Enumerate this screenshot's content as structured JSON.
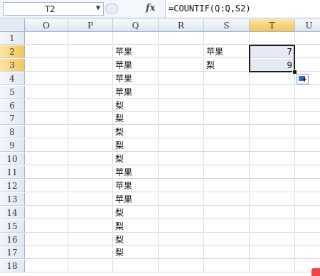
{
  "formula_bar": {
    "name_box": "T2",
    "fx_label": "fx",
    "formula": "=COUNTIF(Q:Q,S2)"
  },
  "columns": [
    "O",
    "P",
    "Q",
    "R",
    "S",
    "T",
    "U"
  ],
  "active_column": "T",
  "rows": [
    {
      "n": "1",
      "Q": "",
      "S": "",
      "T": ""
    },
    {
      "n": "2",
      "Q": "苹果",
      "S": "苹果",
      "T": "7"
    },
    {
      "n": "3",
      "Q": "苹果",
      "S": "梨",
      "T": "9"
    },
    {
      "n": "4",
      "Q": "苹果",
      "S": "",
      "T": ""
    },
    {
      "n": "5",
      "Q": "苹果",
      "S": "",
      "T": ""
    },
    {
      "n": "6",
      "Q": "梨",
      "S": "",
      "T": ""
    },
    {
      "n": "7",
      "Q": "梨",
      "S": "",
      "T": ""
    },
    {
      "n": "8",
      "Q": "梨",
      "S": "",
      "T": ""
    },
    {
      "n": "9",
      "Q": "梨",
      "S": "",
      "T": ""
    },
    {
      "n": "10",
      "Q": "梨",
      "S": "",
      "T": ""
    },
    {
      "n": "11",
      "Q": "苹果",
      "S": "",
      "T": ""
    },
    {
      "n": "12",
      "Q": "苹果",
      "S": "",
      "T": ""
    },
    {
      "n": "13",
      "Q": "苹果",
      "S": "",
      "T": ""
    },
    {
      "n": "14",
      "Q": "梨",
      "S": "",
      "T": ""
    },
    {
      "n": "15",
      "Q": "梨",
      "S": "",
      "T": ""
    },
    {
      "n": "16",
      "Q": "梨",
      "S": "",
      "T": ""
    },
    {
      "n": "17",
      "Q": "梨",
      "S": "",
      "T": ""
    },
    {
      "n": "18",
      "Q": "",
      "S": "",
      "T": ""
    }
  ],
  "selected_rows": [
    "2",
    "3"
  ]
}
